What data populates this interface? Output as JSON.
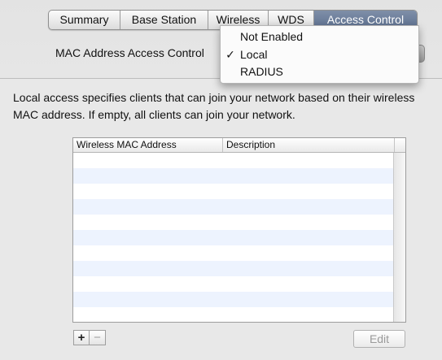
{
  "tabs": [
    {
      "label": "Summary",
      "active": false
    },
    {
      "label": "Base Station",
      "active": false
    },
    {
      "label": "Wireless",
      "active": false
    },
    {
      "label": "WDS",
      "active": false
    },
    {
      "label": "Access Control",
      "active": true
    }
  ],
  "access_control": {
    "label": "MAC Address Access Control",
    "options": [
      {
        "label": "Not Enabled",
        "checked": false
      },
      {
        "label": "Local",
        "checked": true
      },
      {
        "label": "RADIUS",
        "checked": false
      }
    ],
    "check_mark": "✓"
  },
  "description": "Local access specifies clients that can join your network based on their wireless MAC address. If empty, all clients can join your network.",
  "table": {
    "columns": [
      "Wireless MAC Address",
      "Description"
    ],
    "rows": []
  },
  "buttons": {
    "add_label": "+",
    "remove_label": "−",
    "edit_label": "Edit"
  },
  "colors": {
    "active_tab": "#5c6f8f",
    "row_alt": "#edf3fe"
  },
  "icons": {
    "add": "plus-icon",
    "remove": "minus-icon",
    "check": "checkmark-icon"
  }
}
